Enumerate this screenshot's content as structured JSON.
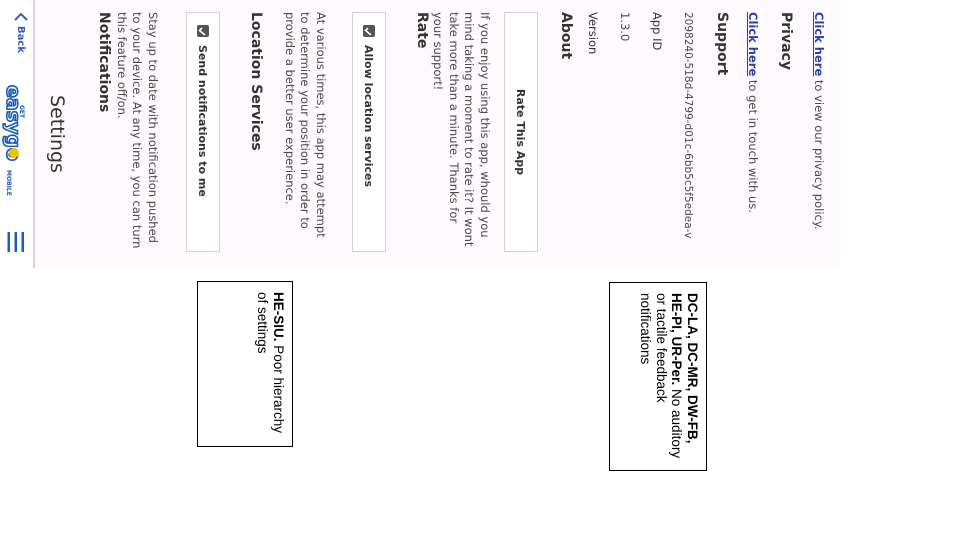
{
  "app": {
    "back_label": "Back",
    "logo_top": "GET",
    "logo_main": "easygo",
    "logo_sub": "MOBILE",
    "title": "Settings"
  },
  "notifications": {
    "heading": "Notifications",
    "description": "Stay up to date with notification pushed to your device. At any time, you can turn this feature off/on.",
    "button_label": "Send notifications to me"
  },
  "location": {
    "heading": "Location Services",
    "description": "At various times, this app may attempt to determine your position in order to provide a better user experience.",
    "button_label": "Allow location services"
  },
  "rate": {
    "heading": "Rate",
    "description": "If you enjoy using this app, whould you mind taking a moment to rate it? It wont take more than a minute. Thanks for your support!",
    "button_label": "Rate This App"
  },
  "about": {
    "heading": "About",
    "version_label": "Version",
    "version_value": "1.3.0",
    "appid_label": "App ID",
    "appid_value": "2098240-518d-4799-d01c-6bb5c5f5edea-v"
  },
  "support": {
    "heading": "Support",
    "link_text": "Click here",
    "rest_text": " to get in touch with us."
  },
  "privacy": {
    "heading": "Privacy",
    "link_text": "Click here",
    "rest_text": " to view our privacy policy."
  },
  "annotations": {
    "note1_codes": "DC-LA, DC-MR, DW-FB, HE-PI, UR-Per.",
    "note1_text": " No auditory or tactile feedback notifications",
    "note2_codes": "HE-SIU.",
    "note2_text": " Poor hierarchy of settings"
  },
  "colors": {
    "link": "#2a3fa8",
    "logo_blue": "#1a5fb4",
    "logo_yellow": "#f2c400"
  }
}
